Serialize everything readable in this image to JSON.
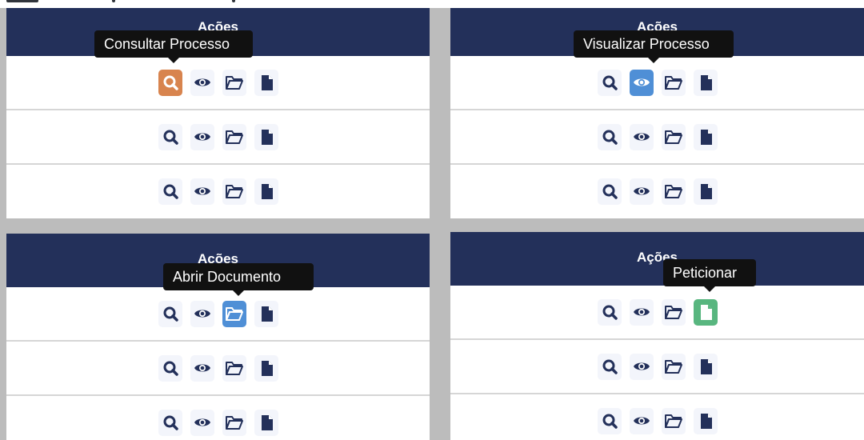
{
  "panels": [
    {
      "id": "top-left",
      "header": "Ações",
      "tooltip": "Consultar Processo",
      "active_action": "search",
      "rows": 3
    },
    {
      "id": "top-right",
      "header": "Ações",
      "tooltip": "Visualizar Processo",
      "active_action": "view",
      "rows": 3
    },
    {
      "id": "bottom-left",
      "header": "Ações",
      "tooltip": "Abrir Documento",
      "active_action": "folder",
      "rows": 3
    },
    {
      "id": "bottom-right",
      "header": "Ações",
      "tooltip": "Peticionar",
      "active_action": "document",
      "rows": 3
    }
  ],
  "actions": [
    {
      "name": "search",
      "icon": "search-icon"
    },
    {
      "name": "view",
      "icon": "eye-icon"
    },
    {
      "name": "folder",
      "icon": "folder-open-icon"
    },
    {
      "name": "document",
      "icon": "document-icon"
    }
  ],
  "colors": {
    "header": "#23305A",
    "separator": "#BCBCBC",
    "tooltip": "#111111",
    "search_active": "#D8844E",
    "view_active": "#4F8FD6",
    "folder_active": "#4F8FD6",
    "document_active": "#58B67F"
  }
}
